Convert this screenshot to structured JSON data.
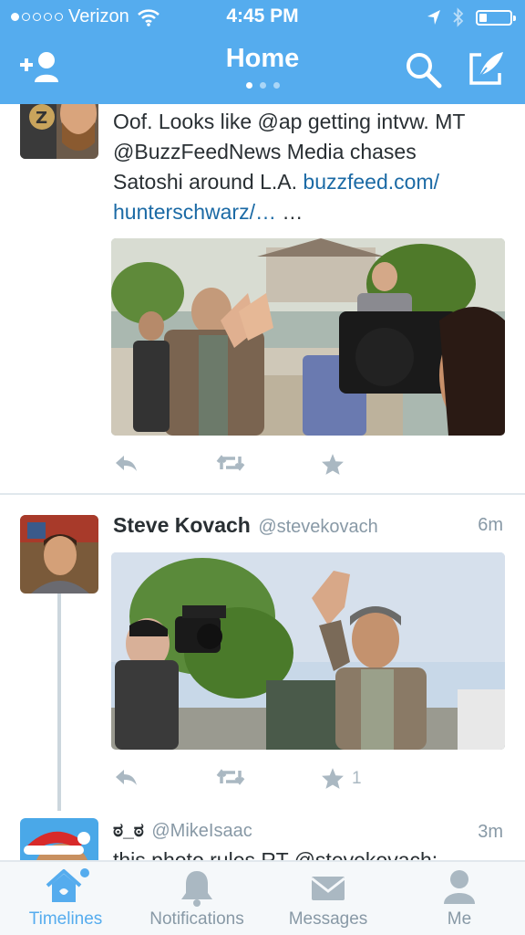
{
  "status_bar": {
    "carrier": "Verizon",
    "signal_bars_filled": 1,
    "signal_bars_total": 5,
    "time": "4:45 PM",
    "battery_level": 0.25
  },
  "nav": {
    "title": "Home",
    "page_count": 3,
    "active_page": 0,
    "icons": [
      "add-user-icon",
      "search-icon",
      "compose-icon"
    ]
  },
  "tweets": [
    {
      "text_plain": "Oof. Looks like @ap getting intvw. MT @BuzzFeedNews Media chases Satoshi around L.A.",
      "line1": "Oof. Looks like @ap getting intvw. MT",
      "line2": "@BuzzFeedNews Media chases",
      "line3_text": "Satoshi around L.A.",
      "line3_link": "buzzfeed.com/",
      "line4_link": "hunterschwarz/…",
      "line4_tail": " …",
      "has_photo": true,
      "favorite_count": ""
    },
    {
      "name": "Steve Kovach",
      "handle": "@stevekovach",
      "time": "6m",
      "has_photo": true,
      "favorite_count": "1"
    },
    {
      "name": "ಠ_ಠ",
      "handle": "@MikeIsaac",
      "time": "3m",
      "text_partial": "this photo rules RT @stevekovach:"
    }
  ],
  "tabs": [
    {
      "label": "Timelines",
      "icon": "home-icon",
      "active": true,
      "has_badge": true
    },
    {
      "label": "Notifications",
      "icon": "bell-icon",
      "active": false
    },
    {
      "label": "Messages",
      "icon": "envelope-icon",
      "active": false
    },
    {
      "label": "Me",
      "icon": "person-icon",
      "active": false
    }
  ],
  "colors": {
    "brand": "#55acee",
    "link": "#1b6aa5",
    "muted": "#8899a6",
    "action_icon": "#aab8c2"
  }
}
